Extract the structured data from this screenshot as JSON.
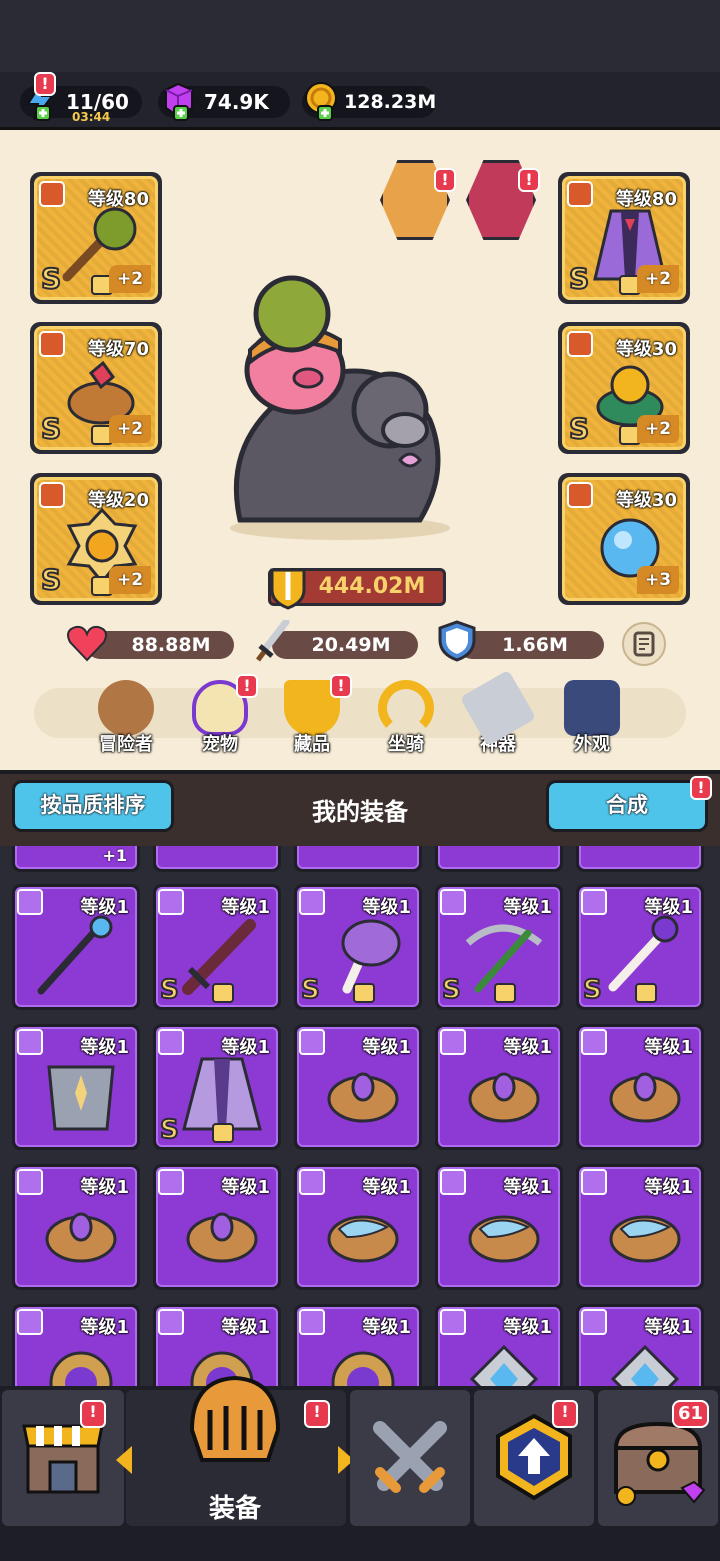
{
  "resources": {
    "energy": "11/60",
    "energy_timer": "03:44",
    "gems": "74.9K",
    "gold": "128.23M"
  },
  "hero": {
    "slots_left": [
      {
        "level": "等级80",
        "grade": "S",
        "plus": "+2",
        "icon": "spiked-club-icon"
      },
      {
        "level": "等级70",
        "grade": "S",
        "plus": "+2",
        "icon": "ruby-bracelet-icon"
      },
      {
        "level": "等级20",
        "grade": "S",
        "plus": "+2",
        "icon": "golden-amulet-icon"
      }
    ],
    "slots_right": [
      {
        "level": "等级80",
        "grade": "S",
        "plus": "+2",
        "icon": "purple-cape-icon"
      },
      {
        "level": "等级30",
        "grade": "S",
        "plus": "+2",
        "icon": "emerald-ring-icon"
      },
      {
        "level": "等级30",
        "grade": "",
        "plus": "+3",
        "icon": "blue-orb-necklace-icon"
      }
    ],
    "power": "444.02M",
    "hp": "88.88M",
    "attack": "20.49M",
    "defense": "1.66M"
  },
  "menu": [
    {
      "label": "冒险者",
      "icon": "adventurer-icon",
      "badge": false
    },
    {
      "label": "宠物",
      "icon": "pet-egg-icon",
      "badge": true
    },
    {
      "label": "藏品",
      "icon": "collection-trophy-icon",
      "badge": true
    },
    {
      "label": "坐骑",
      "icon": "horseshoe-icon",
      "badge": false
    },
    {
      "label": "神器",
      "icon": "artifact-hammer-icon",
      "badge": false
    },
    {
      "label": "外观",
      "icon": "outfit-icon",
      "badge": false
    }
  ],
  "equipment": {
    "sort_button": "按品质排序",
    "title": "我的装备",
    "merge_button": "合成",
    "partial_row_plus": "+1",
    "rows": [
      [
        {
          "level": "等级1",
          "grade": "",
          "icon": "magic-staff-icon"
        },
        {
          "level": "等级1",
          "grade": "S",
          "icon": "dark-sword-icon"
        },
        {
          "level": "等级1",
          "grade": "S",
          "icon": "mushroom-mace-icon"
        },
        {
          "level": "等级1",
          "grade": "S",
          "icon": "green-crossbow-icon"
        },
        {
          "level": "等级1",
          "grade": "S",
          "icon": "bone-scepter-icon"
        }
      ],
      [
        {
          "level": "等级1",
          "grade": "",
          "icon": "steel-armor-icon"
        },
        {
          "level": "等级1",
          "grade": "S",
          "icon": "purple-cape-icon"
        },
        {
          "level": "等级1",
          "grade": "",
          "icon": "gem-bracelet-icon"
        },
        {
          "level": "等级1",
          "grade": "",
          "icon": "gem-bracelet-icon"
        },
        {
          "level": "等级1",
          "grade": "",
          "icon": "gem-bracelet-icon"
        }
      ],
      [
        {
          "level": "等级1",
          "grade": "",
          "icon": "gem-bracelet-icon"
        },
        {
          "level": "等级1",
          "grade": "",
          "icon": "gem-bracelet-icon"
        },
        {
          "level": "等级1",
          "grade": "",
          "icon": "wave-bracelet-icon"
        },
        {
          "level": "等级1",
          "grade": "",
          "icon": "wave-bracelet-icon"
        },
        {
          "level": "等级1",
          "grade": "",
          "icon": "wave-bracelet-icon"
        }
      ],
      [
        {
          "level": "等级1",
          "grade": "",
          "icon": "eye-amulet-icon"
        },
        {
          "level": "等级1",
          "grade": "",
          "icon": "eye-amulet-icon"
        },
        {
          "level": "等级1",
          "grade": "",
          "icon": "eye-amulet-icon"
        },
        {
          "level": "等级1",
          "grade": "",
          "icon": "crystal-amulet-icon"
        },
        {
          "level": "等级1",
          "grade": "",
          "icon": "crystal-amulet-icon"
        }
      ]
    ]
  },
  "nav": {
    "active_label": "装备",
    "chest_count": "61",
    "tabs": [
      "shop-icon",
      "equipment-helmet-icon",
      "battle-swords-icon",
      "upgrade-badge-icon",
      "treasure-chest-icon"
    ]
  },
  "colors": {
    "epic_purple": "#8d3ad4",
    "legendary_gold": "#f0b43c",
    "button_blue": "#4fc4ea",
    "alert_red": "#e83a4f"
  }
}
